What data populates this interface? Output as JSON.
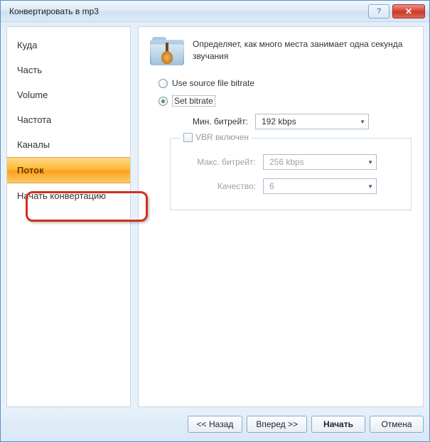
{
  "window": {
    "title": "Конвертировать в mp3"
  },
  "sidebar": {
    "items": [
      {
        "label": "Куда"
      },
      {
        "label": "Часть"
      },
      {
        "label": "Volume"
      },
      {
        "label": "Частота"
      },
      {
        "label": "Каналы"
      },
      {
        "label": "Поток"
      },
      {
        "label": "Начать конвертацию"
      }
    ]
  },
  "content": {
    "description": "Определяет, как много места занимает одна секунда звучания",
    "radio": {
      "source": "Use source file bitrate",
      "set": "Set bitrate"
    },
    "min_bitrate_label": "Мин. битрейт:",
    "min_bitrate_value": "192 kbps",
    "vbr_label": "VBR включен",
    "max_bitrate_label": "Макс. битрейт:",
    "max_bitrate_value": "256 kbps",
    "quality_label": "Качество:",
    "quality_value": "6"
  },
  "footer": {
    "back": "<< Назад",
    "forward": "Вперед >>",
    "start": "Начать",
    "cancel": "Отмена"
  }
}
